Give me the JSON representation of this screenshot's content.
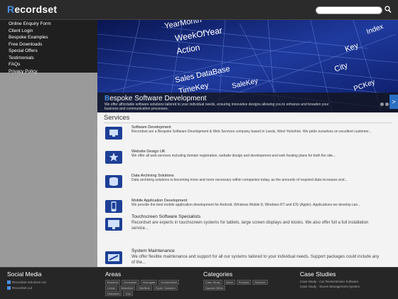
{
  "header": {
    "logo_first": "R",
    "logo_rest": "ecordset",
    "search_placeholder": ""
  },
  "nav": {
    "items": [
      "Online Enquiry Form",
      "Client Login",
      "Bespoke Examples",
      "Free Downloads",
      "Special Offers",
      "Testimonials",
      "FAQs",
      "Privacy Policy"
    ]
  },
  "hero": {
    "title_first": "B",
    "title_rest": "espoke Software Development",
    "description": "We offer affordable software solutions tailored to your individual needs, ensuring innovative designs allowing you to enhance and broaden your business and communication processes.",
    "keywords": [
      "YearMonth",
      "WeekOfYear",
      "Action",
      "Sales DataBase",
      "TimeKey",
      "SaleKey",
      "PCKey",
      "City",
      "Key",
      "Index"
    ],
    "next_arrow": ">"
  },
  "services": {
    "heading": "Services",
    "items": [
      {
        "title": "Software Development",
        "description": "Recordset are a Bespoke Software Development & Web Services company based in Leeds, West Yorkshire. We pride ourselves on excellent customer...",
        "icon": "monitor-icon"
      },
      {
        "title": "Website Design UK",
        "description": "We offer all web services including domain registration, website design and development and web hosting plans for both the site...",
        "icon": "star-icon"
      },
      {
        "title": "Data Archiving Solutions",
        "description": "Data archiving solutions is becoming more and more necessary within companies today, as the amounts of required data increases and...",
        "icon": "database-icon"
      },
      {
        "title": "Mobile Application Development",
        "description": "We provide the best mobile application development for Android, Windows Mobile 8, Windows RT and iOS (Apple). Applications we develop can...",
        "icon": "phone-icon"
      },
      {
        "title": "Touchscreen Software Specialists",
        "description": "Recordset are experts in touchscreen systems for tablets, large screen displays and kiosks.  We also offer full a full installation service...",
        "icon": "touchscreen-icon"
      },
      {
        "title": "System Maintenance",
        "description": "We offer flexible maintenance and support for all our systems tailored to your individual needs. Support packages could include any of the...",
        "icon": "wrench-icon"
      }
    ]
  },
  "footer": {
    "social": {
      "heading": "Social Media",
      "lines": [
        "Recordset Solutions Ltd",
        "Recordset Ltd"
      ]
    },
    "areas": {
      "heading": "Areas",
      "tags": [
        "Bradford",
        "Doncaster",
        "Harrogate",
        "Huddersfield",
        "Leeds",
        "Wakefield",
        "Sheffield",
        "South Yorkshire",
        "Wakefield",
        "York"
      ]
    },
    "categories": {
      "heading": "Categories",
      "tags": [
        "Case Study",
        "News",
        "Process",
        "Services",
        "Special Offers"
      ]
    },
    "case_studies": {
      "heading": "Case Studies",
      "lines": [
        "Case Study - Car Rental Broker Software",
        "Case Study - Stores Management System"
      ]
    }
  }
}
